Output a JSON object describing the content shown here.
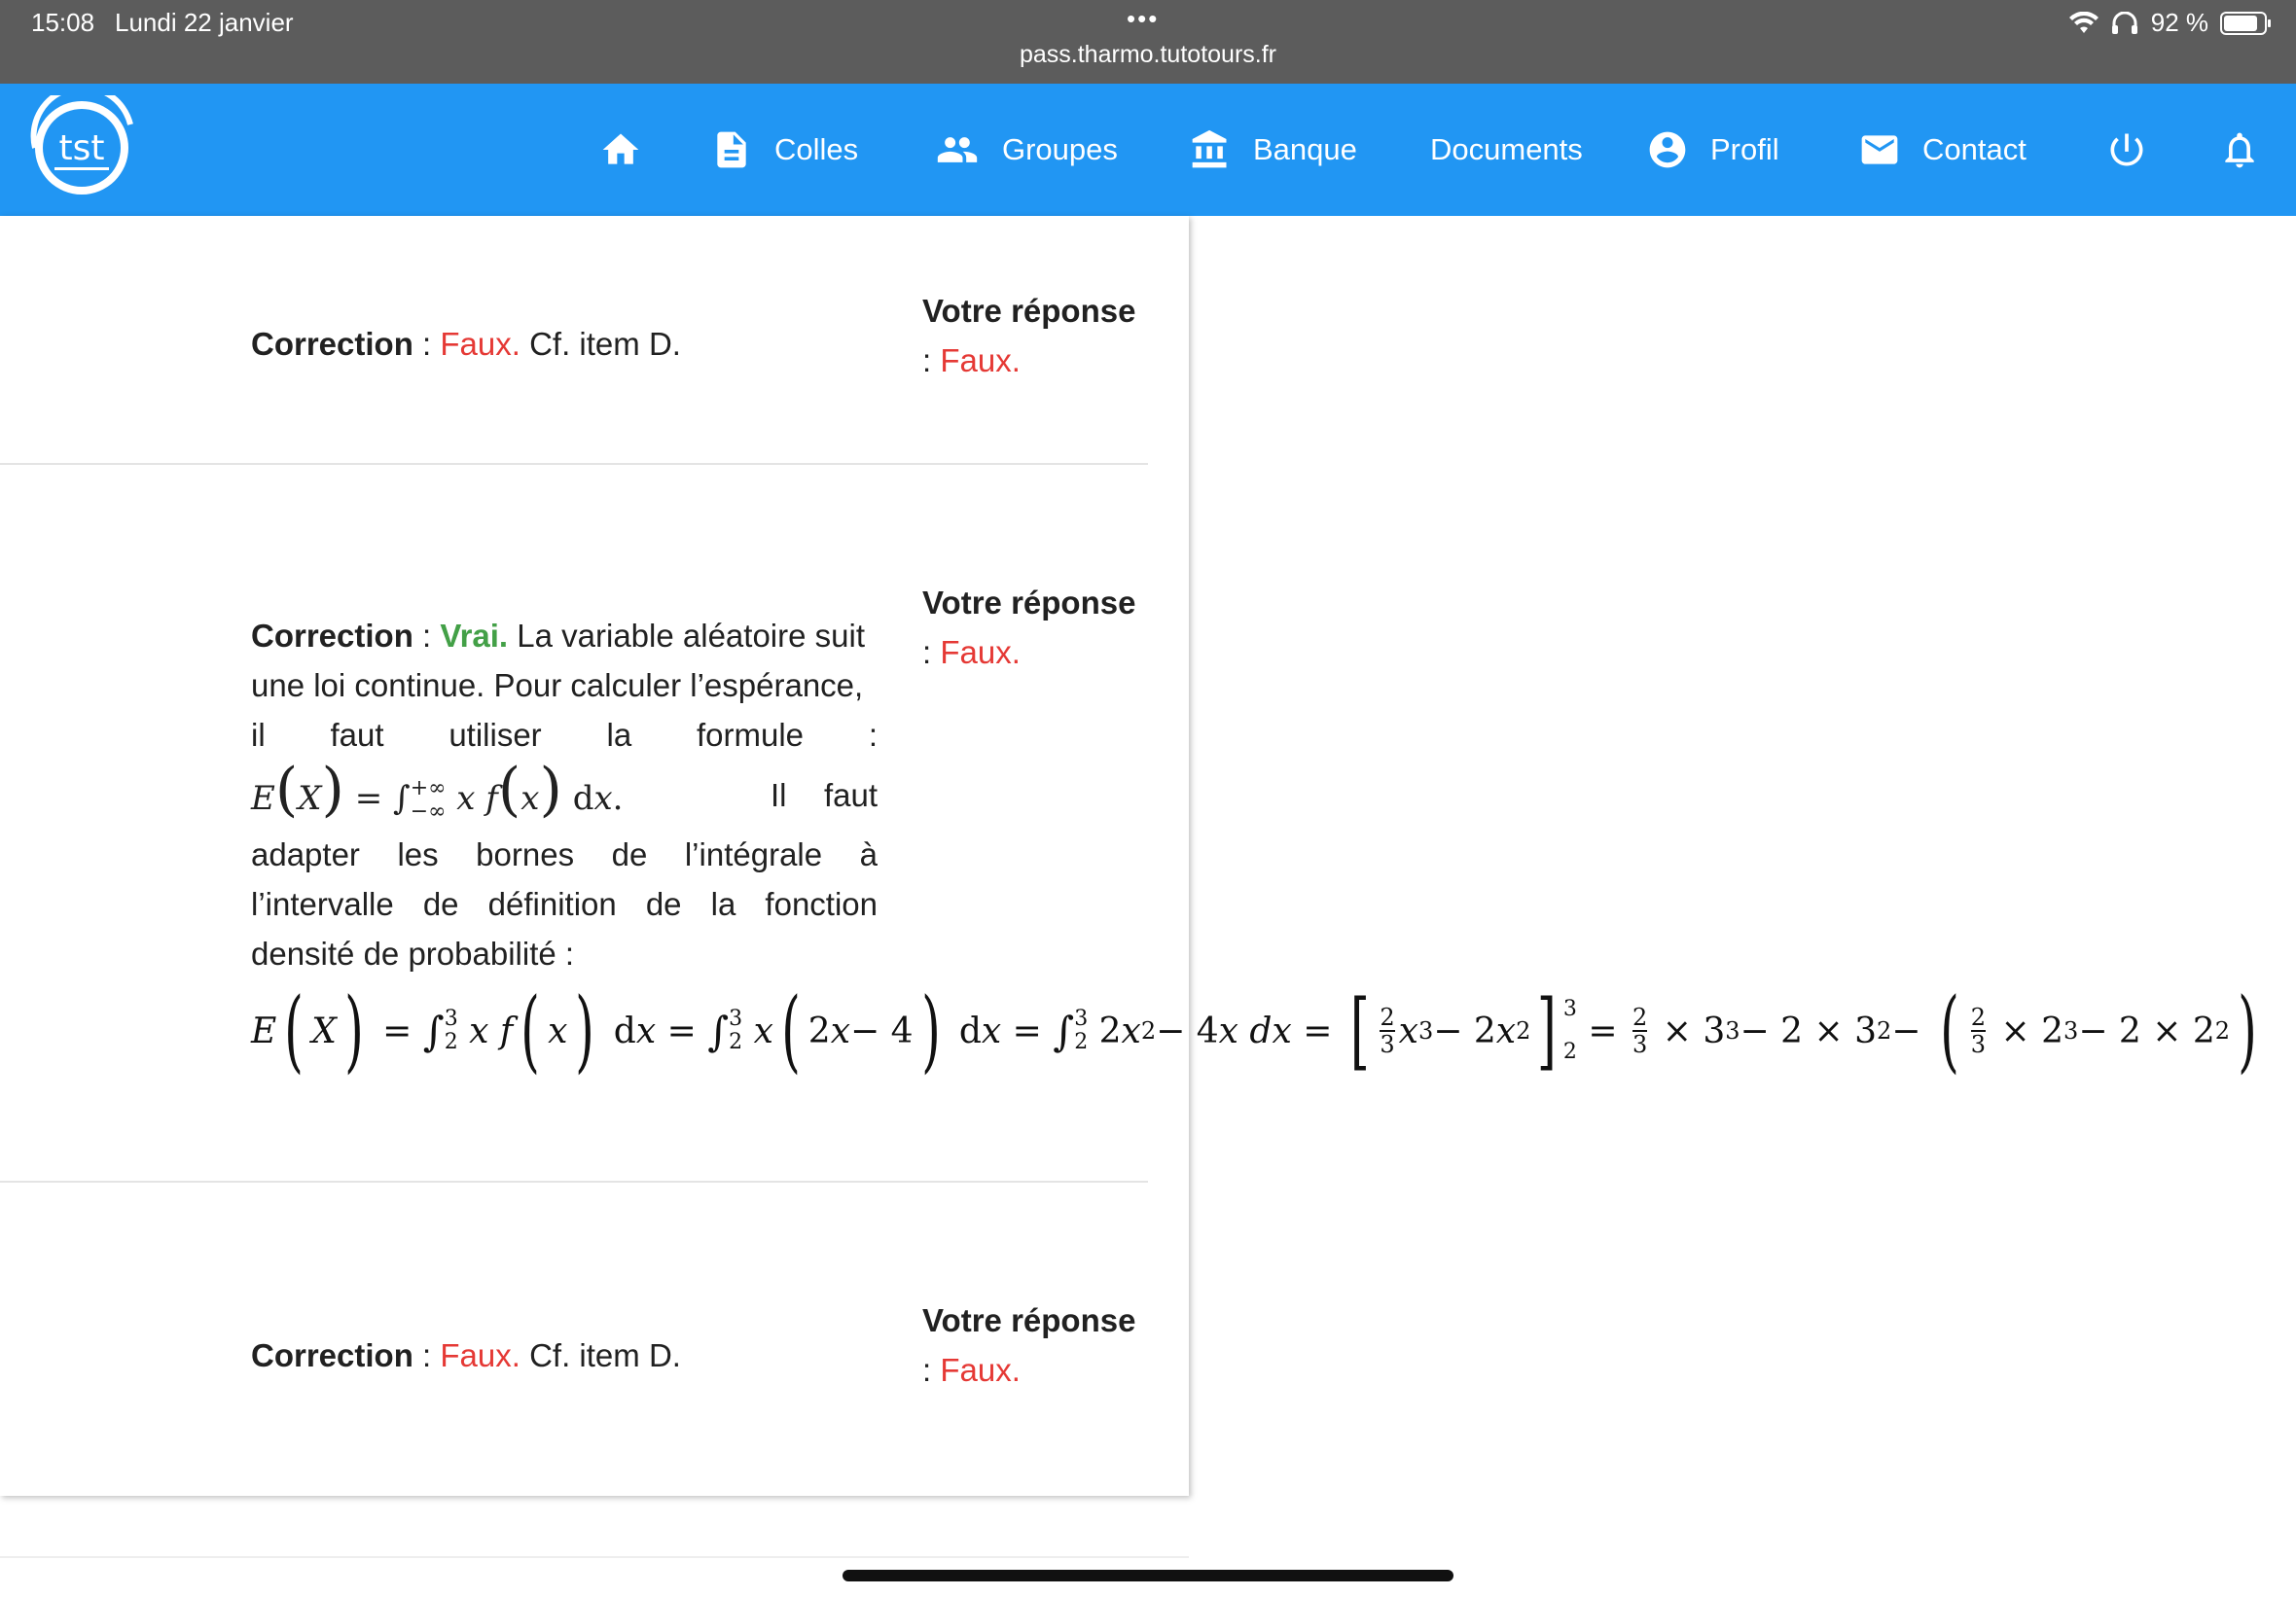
{
  "status_bar": {
    "time": "15:08",
    "date": "Lundi 22 janvier",
    "url": "pass.tharmo.tutotours.fr",
    "battery": "92 %"
  },
  "nav": {
    "items": [
      {
        "label": "",
        "icon": "home-icon"
      },
      {
        "label": "Colles",
        "icon": "document-icon"
      },
      {
        "label": "Groupes",
        "icon": "group-icon"
      },
      {
        "label": "Banque",
        "icon": "bank-icon"
      },
      {
        "label": "Documents",
        "icon": ""
      },
      {
        "label": "Profil",
        "icon": "account-icon"
      },
      {
        "label": "Contact",
        "icon": "mail-icon"
      },
      {
        "label": "",
        "icon": "power-icon"
      },
      {
        "label": "",
        "icon": "bell-icon"
      }
    ],
    "accent": "#2196f3"
  },
  "items": [
    {
      "correction_label": "Correction",
      "sep": " : ",
      "verdict": "Faux.",
      "text": " Cf. item D.",
      "answer_title": "Votre réponse",
      "answer_sep": ": ",
      "answer_value": "Faux."
    },
    {
      "correction_label": "Correction",
      "sep": " : ",
      "verdict": "Vrai.",
      "line1": " La variable aléatoire suit",
      "line2": "une loi continue. Pour calculer l’espérance,",
      "line3": "il faut utiliser la formule :",
      "inline_after": "Il faut",
      "line5": "adapter les bornes de l’intégrale à",
      "line6": "l’intervalle de définition de la fonction",
      "line7": "densité de probabilité :",
      "answer_title": "Votre réponse",
      "answer_sep": ": ",
      "answer_value": "Faux."
    },
    {
      "correction_label": "Correction",
      "sep": " : ",
      "verdict": "Faux.",
      "text": " Cf. item D.",
      "answer_title": "Votre réponse",
      "answer_sep": ": ",
      "answer_value": "Faux."
    }
  ],
  "colors": {
    "faux": "#e53935",
    "vrai": "#43a047"
  }
}
